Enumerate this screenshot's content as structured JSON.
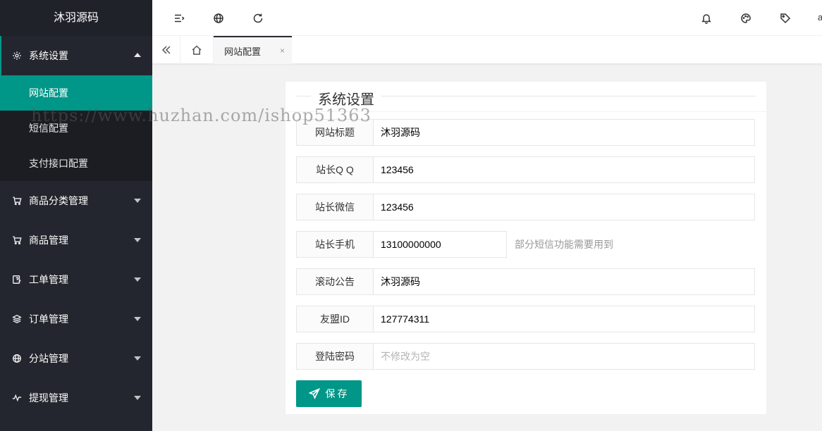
{
  "sidebar": {
    "logo": "沐羽源码",
    "menu": [
      {
        "label": "系统设置",
        "icon": "gear-icon"
      },
      {
        "label": "商品分类管理",
        "icon": "cart-icon"
      },
      {
        "label": "商品管理",
        "icon": "cart-icon"
      },
      {
        "label": "工单管理",
        "icon": "ticket-icon"
      },
      {
        "label": "订单管理",
        "icon": "layers-icon"
      },
      {
        "label": "分站管理",
        "icon": "globe-icon"
      },
      {
        "label": "提现管理",
        "icon": "pulse-icon"
      }
    ],
    "submenu": [
      "网站配置",
      "短信配置",
      "支付接口配置"
    ]
  },
  "header": {
    "user_initial": "a"
  },
  "tabs": {
    "active_label": "网站配置",
    "close_glyph": "×"
  },
  "form": {
    "title": "系统设置",
    "fields": [
      {
        "label": "网站标题",
        "value": "沐羽源码",
        "placeholder": ""
      },
      {
        "label": "站长Q Q",
        "value": "123456",
        "placeholder": ""
      },
      {
        "label": "站长微信",
        "value": "123456",
        "placeholder": ""
      },
      {
        "label": "站长手机",
        "value": "13100000000",
        "placeholder": "",
        "tip": "部分短信功能需要用到"
      },
      {
        "label": "滚动公告",
        "value": "沐羽源码",
        "placeholder": ""
      },
      {
        "label": "友盟ID",
        "value": "127774311",
        "placeholder": ""
      },
      {
        "label": "登陆密码",
        "value": "",
        "placeholder": "不修改为空"
      }
    ],
    "save_label": "保存"
  },
  "watermark": "https://www.huzhan.com/ishop51363",
  "colors": {
    "accent": "#009688",
    "sidebar": "#23262e"
  }
}
